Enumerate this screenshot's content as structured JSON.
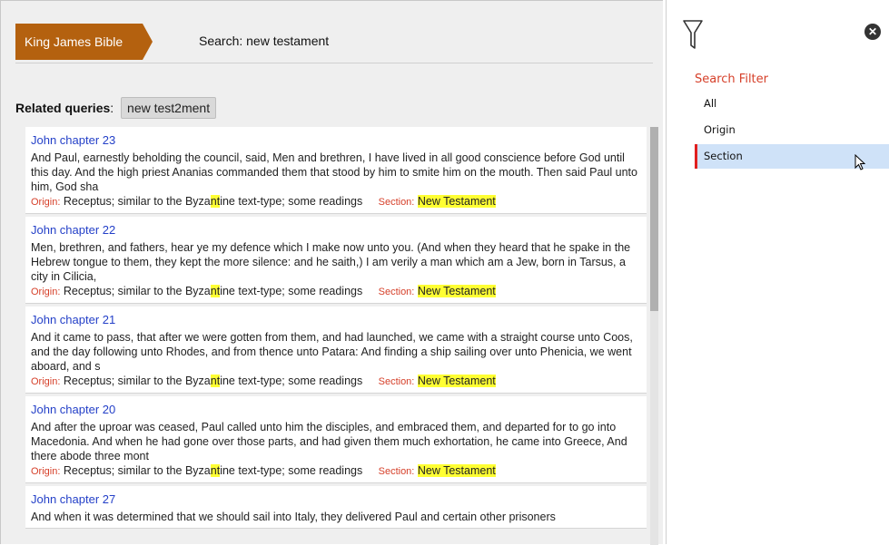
{
  "header": {
    "breadcrumb": "King James Bible",
    "search_title": "Search: new testament"
  },
  "related": {
    "label": "Related queries",
    "colon": ":",
    "chip": "new test2ment"
  },
  "results": [
    {
      "title": "John chapter 23",
      "text": "And Paul, earnestly beholding the council, said, Men and brethren, I have lived in all good conscience before God until this day. And the high priest Ananias commanded them that stood by him to smite him on the mouth. Then said Paul unto him, God sha",
      "origin_label": "Origin:",
      "origin_pre": "Receptus; similar to the Byza",
      "origin_hl": "nt",
      "origin_post": "ine text-type; some readings",
      "section_label": "Section:",
      "section_value": "New Testament"
    },
    {
      "title": "John chapter 22",
      "text": "Men, brethren, and fathers, hear ye my defence which I make now unto you. (And when they heard that he spake in the Hebrew tongue to them, they kept the more silence: and he saith,) I am verily a man which am a Jew, born in Tarsus, a city in Cilicia,",
      "origin_label": "Origin:",
      "origin_pre": "Receptus; similar to the Byza",
      "origin_hl": "nt",
      "origin_post": "ine text-type; some readings",
      "section_label": "Section:",
      "section_value": "New Testament"
    },
    {
      "title": "John chapter 21",
      "text": "And it came to pass, that after we were gotten from them, and had launched, we came with a straight course unto Coos, and the day following unto Rhodes, and from thence unto Patara: And finding a ship sailing over unto Phenicia, we went aboard, and s",
      "origin_label": "Origin:",
      "origin_pre": "Receptus; similar to the Byza",
      "origin_hl": "nt",
      "origin_post": "ine text-type; some readings",
      "section_label": "Section:",
      "section_value": "New Testament"
    },
    {
      "title": "John chapter 20",
      "text": "And after the uproar was ceased, Paul called unto him the disciples, and embraced them, and departed for to go into Macedonia. And when he had gone over those parts, and had given them much exhortation, he came into Greece, And there abode three mont",
      "origin_label": "Origin:",
      "origin_pre": "Receptus; similar to the Byza",
      "origin_hl": "nt",
      "origin_post": "ine text-type; some readings",
      "section_label": "Section:",
      "section_value": "New Testament"
    },
    {
      "title": "John chapter 27",
      "text": "And when it was determined that we should sail into Italy, they delivered Paul and certain other prisoners"
    }
  ],
  "sidebar": {
    "title": "Search Filter",
    "items": [
      "All",
      "Origin",
      "Section"
    ],
    "active_item": "Section",
    "icons": {
      "filter": "filter-icon",
      "close": "close-icon"
    }
  },
  "colors": {
    "breadcrumb": "#b4610f",
    "label_red": "#d6402a",
    "link_blue": "#2440c8",
    "highlight": "#ffff33",
    "active_bg": "#cfe2f8",
    "active_bar": "#e01f1f"
  }
}
